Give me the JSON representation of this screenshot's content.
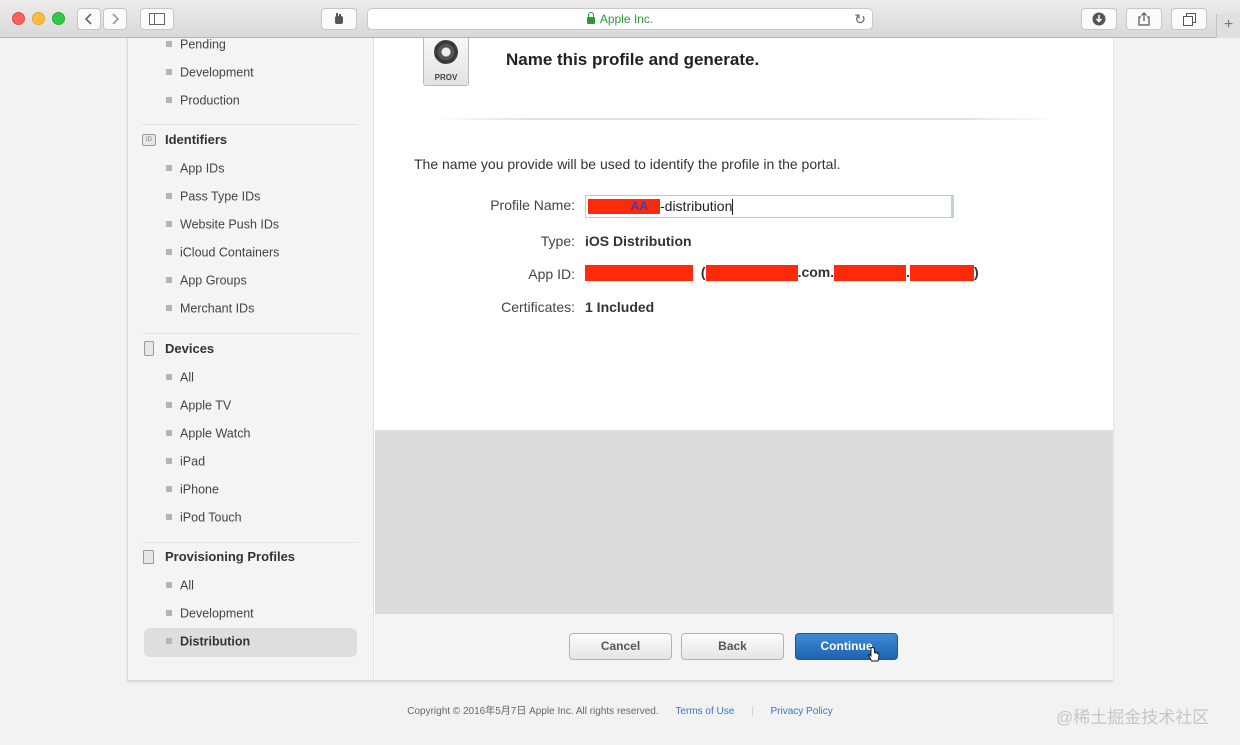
{
  "browser": {
    "url_label": "Apple Inc.",
    "reload_glyph": "↻",
    "new_tab_glyph": "+"
  },
  "sidebar": {
    "certificates_items": [
      "Pending",
      "Development",
      "Production"
    ],
    "identifiers": {
      "heading": "Identifiers",
      "icon_text": "ID",
      "items": [
        "App IDs",
        "Pass Type IDs",
        "Website Push IDs",
        "iCloud Containers",
        "App Groups",
        "Merchant IDs"
      ]
    },
    "devices": {
      "heading": "Devices",
      "items": [
        "All",
        "Apple TV",
        "Apple Watch",
        "iPad",
        "iPhone",
        "iPod Touch"
      ]
    },
    "profiles": {
      "heading": "Provisioning Profiles",
      "items": [
        "All",
        "Development",
        "Distribution"
      ],
      "selected": "Distribution"
    }
  },
  "main": {
    "icon_label": "PROV",
    "title": "Name this profile and generate.",
    "description": "The name you provide will be used to identify the profile in the portal.",
    "fields": {
      "profile_name_label": "Profile Name:",
      "profile_name_visible_part": "AA",
      "profile_name_suffix": "-distribution",
      "type_label": "Type:",
      "type_value": "iOS Distribution",
      "app_id_label": "App ID:",
      "app_id_paren_open": "(",
      "app_id_com": ".com.",
      "app_id_dot": ".",
      "app_id_paren_close": ")",
      "certificates_label": "Certificates:",
      "certificates_value": "1 Included"
    }
  },
  "buttons": {
    "cancel": "Cancel",
    "back": "Back",
    "continue": "Continue"
  },
  "footer": {
    "copyright": "Copyright © 2016年5月7日 Apple Inc. All rights reserved.",
    "terms": "Terms of Use",
    "separator": "|",
    "privacy": "Privacy Policy"
  },
  "watermark": "@稀土掘金技术社区"
}
